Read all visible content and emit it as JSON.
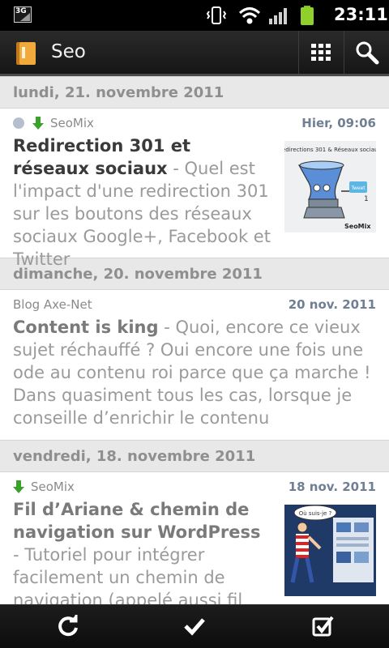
{
  "status_bar": {
    "network": "3G",
    "time": "23:11"
  },
  "action_bar": {
    "title": "Seo",
    "grid_icon": "grid-icon",
    "search_icon": "search-icon",
    "app_icon": "feed-folder-icon"
  },
  "sections": [
    {
      "date": "lundi, 21. novembre 2011",
      "article": {
        "source": "SeoMix",
        "time": "Hier, 09:06",
        "title": "Redirection 301 et réseaux sociaux",
        "excerpt": " - Quel est l'impact d'une redirection 301 sur les boutons des réseaux sociaux Google+, Facebook et Twitter",
        "thumb_caption": "Redirections 301 & Réseaux sociaux",
        "thumb_badge": "Tweet",
        "thumb_brand": "SeoMix"
      }
    },
    {
      "date": "dimanche, 20. novembre 2011",
      "article": {
        "source": "Blog Axe-Net",
        "time": "20 nov. 2011",
        "title": "Content is king",
        "excerpt": " - Quoi, encore ce vieux sujet réchauffé ? Oui encore une fois une ode au contenu roi parce que ça marche ! Dans quasiment tous les cas, lorsque je conseille d’enrichir le contenu"
      }
    },
    {
      "date": "vendredi, 18. novembre 2011",
      "article": {
        "source": "SeoMix",
        "time": "18 nov. 2011",
        "title": "Fil d’Ariane & chemin de navigation sur WordPress",
        "excerpt": " - Tutoriel pour intégrer facilement un chemin de navigation (appelé aussi fil",
        "thumb_caption": "Où suis-je ?"
      }
    }
  ],
  "bottom_bar": {
    "refresh_icon": "refresh-icon",
    "mark_read_icon": "checkmark-icon",
    "select_icon": "checkbox-icon"
  },
  "colors": {
    "date_header_bg": "#e8e8e8",
    "accent_date": "#6f7f94",
    "unread_arrow": "#3aa12a"
  }
}
